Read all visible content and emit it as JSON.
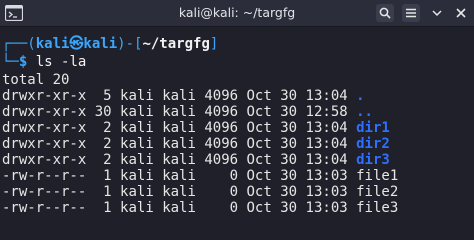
{
  "window": {
    "title": "kali@kali: ~/targfg"
  },
  "titlebar_icons": {
    "app": "terminal-app-icon",
    "search": "search-icon",
    "menu": "hamburger-menu-icon",
    "minimize": "minimize-icon",
    "close": "close-icon"
  },
  "prompt": {
    "open": "┌──(",
    "user": "kali㉿kali",
    "mid": ")-[",
    "path": "~/targfg",
    "close": "]",
    "lead": "└─",
    "dollar": "$",
    "command": "ls -la"
  },
  "listing": {
    "total": "total 20",
    "rows": [
      {
        "perms": "drwxr-xr-x",
        "links": " 5",
        "owner": "kali",
        "group": "kali",
        "size": "4096",
        "month": "Oct",
        "day": "30",
        "time": "13:04",
        "name": ".",
        "is_dir": true
      },
      {
        "perms": "drwxr-xr-x",
        "links": "30",
        "owner": "kali",
        "group": "kali",
        "size": "4096",
        "month": "Oct",
        "day": "30",
        "time": "12:58",
        "name": "..",
        "is_dir": true
      },
      {
        "perms": "drwxr-xr-x",
        "links": " 2",
        "owner": "kali",
        "group": "kali",
        "size": "4096",
        "month": "Oct",
        "day": "30",
        "time": "13:04",
        "name": "dir1",
        "is_dir": true
      },
      {
        "perms": "drwxr-xr-x",
        "links": " 2",
        "owner": "kali",
        "group": "kali",
        "size": "4096",
        "month": "Oct",
        "day": "30",
        "time": "13:04",
        "name": "dir2",
        "is_dir": true
      },
      {
        "perms": "drwxr-xr-x",
        "links": " 2",
        "owner": "kali",
        "group": "kali",
        "size": "4096",
        "month": "Oct",
        "day": "30",
        "time": "13:04",
        "name": "dir3",
        "is_dir": true
      },
      {
        "perms": "-rw-r--r--",
        "links": " 1",
        "owner": "kali",
        "group": "kali",
        "size": "   0",
        "month": "Oct",
        "day": "30",
        "time": "13:03",
        "name": "file1",
        "is_dir": false
      },
      {
        "perms": "-rw-r--r--",
        "links": " 1",
        "owner": "kali",
        "group": "kali",
        "size": "   0",
        "month": "Oct",
        "day": "30",
        "time": "13:03",
        "name": "file2",
        "is_dir": false
      },
      {
        "perms": "-rw-r--r--",
        "links": " 1",
        "owner": "kali",
        "group": "kali",
        "size": "   0",
        "month": "Oct",
        "day": "30",
        "time": "13:03",
        "name": "file3",
        "is_dir": false
      }
    ]
  },
  "colors": {
    "background": "#1f2029",
    "titlebar": "#2b2d3a",
    "prompt_accent": "#3aa7ff",
    "directory": "#2f6fff",
    "text": "#e6e6e6"
  }
}
